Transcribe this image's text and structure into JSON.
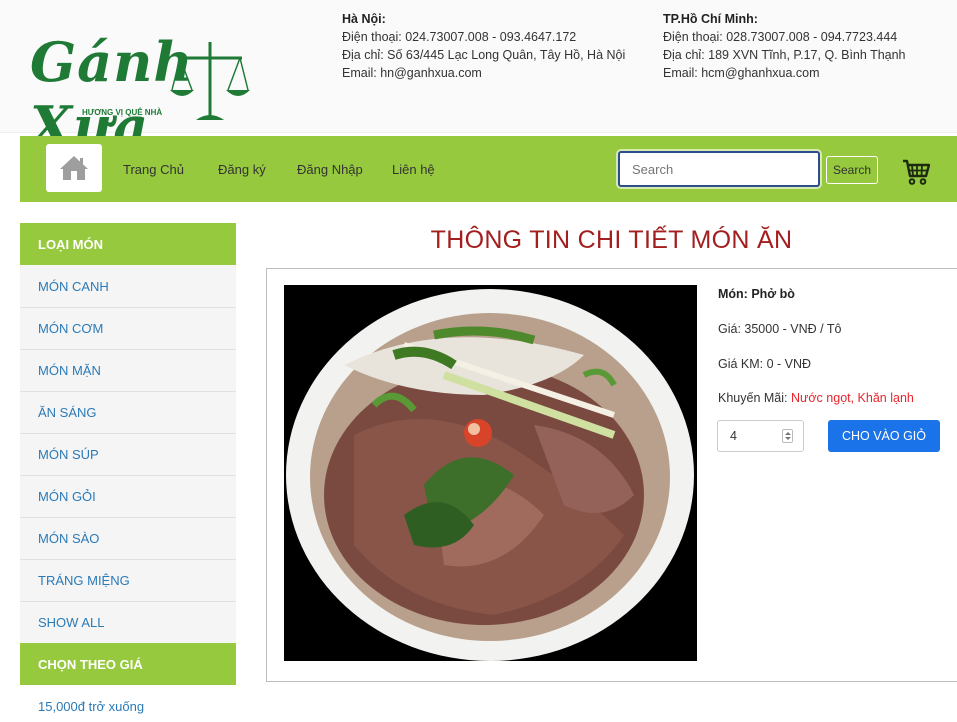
{
  "brand": {
    "logo_text": "Gánh Xưa",
    "tagline": "HƯƠNG VỊ QUÊ NHÀ"
  },
  "contacts": {
    "hanoi": {
      "city": "Hà Nội:",
      "phone": "Điện thoại: 024.73007.008 - 093.4647.172",
      "address": "Địa chỉ: Số 63/445 Lạc Long Quân, Tây Hồ, Hà Nội",
      "email": "Email: hn@ganhxua.com"
    },
    "hcm": {
      "city": "TP.Hồ Chí Minh:",
      "phone": "Điện thoại: 028.73007.008 - 094.7723.444",
      "address": "Địa chỉ: 189 XVN Tĩnh, P.17, Q. Bình Thạnh",
      "email": "Email: hcm@ghanhxua.com"
    }
  },
  "nav": {
    "links": [
      "Trang Chủ",
      "Đăng ký",
      "Đăng Nhập",
      "Liên hệ"
    ],
    "search_placeholder": "Search",
    "search_button": "Search"
  },
  "sidebar": {
    "category_title": "LOẠI MÓN",
    "categories": [
      "MÓN CANH",
      "MÓN CƠM",
      "MÓN MẶN",
      "ĂN SÁNG",
      "MÓN SÚP",
      "MÓN GỎI",
      "MÓN SÀO",
      "TRÁNG MIỆNG",
      "SHOW ALL"
    ],
    "price_title": "CHỌN THEO GIÁ",
    "price_filters": [
      "15,000đ trở xuống"
    ]
  },
  "product": {
    "page_title": "THÔNG TIN CHI TIẾT MÓN ĂN",
    "name": "Món: Phở bò",
    "price": "Giá: 35000 - VNĐ / Tô",
    "sale_price": "Giá KM: 0 - VNĐ",
    "promo_label": "Khuyến Mãi: ",
    "promo_value": "Nước ngọt, Khăn lạnh",
    "quantity": "4",
    "add_to_cart": "CHO VÀO GIỎ"
  },
  "colors": {
    "accent_green": "#96c93d",
    "title_red": "#a31f1f",
    "link_blue": "#2a7ab8",
    "button_blue": "#1a73e8",
    "promo_red": "#e8262d"
  },
  "icons": [
    "home-icon",
    "cart-icon"
  ]
}
